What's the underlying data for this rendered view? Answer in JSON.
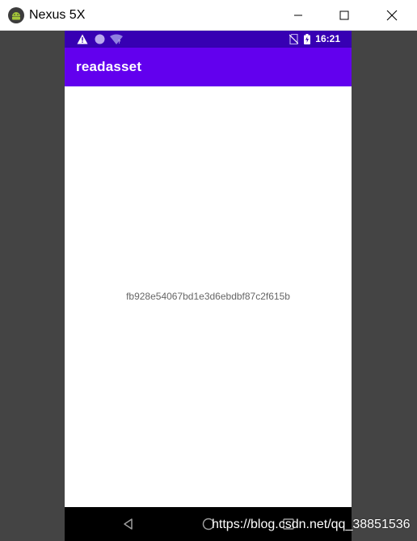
{
  "window": {
    "title": "Nexus 5X",
    "icons": {
      "app": "android-icon",
      "minimize": "minimize-icon",
      "maximize": "maximize-icon",
      "close": "close-icon"
    }
  },
  "statusbar": {
    "time": "16:21",
    "icons": [
      "warning-icon",
      "circle-icon",
      "wifi-icon",
      "no-sim-icon",
      "battery-charging-icon"
    ]
  },
  "appbar": {
    "title": "readasset"
  },
  "content": {
    "text": "fb928e54067bd1e3d6ebdbf87c2f615b"
  },
  "navbar": {
    "icons": [
      "back-icon",
      "home-icon",
      "recents-icon"
    ]
  },
  "watermark": "https://blog.csdn.net/qq_38851536",
  "colors": {
    "status_bar": "#3700b3",
    "app_bar": "#6200ee",
    "nav_bar": "#000000",
    "emulator_frame": "#444444"
  }
}
